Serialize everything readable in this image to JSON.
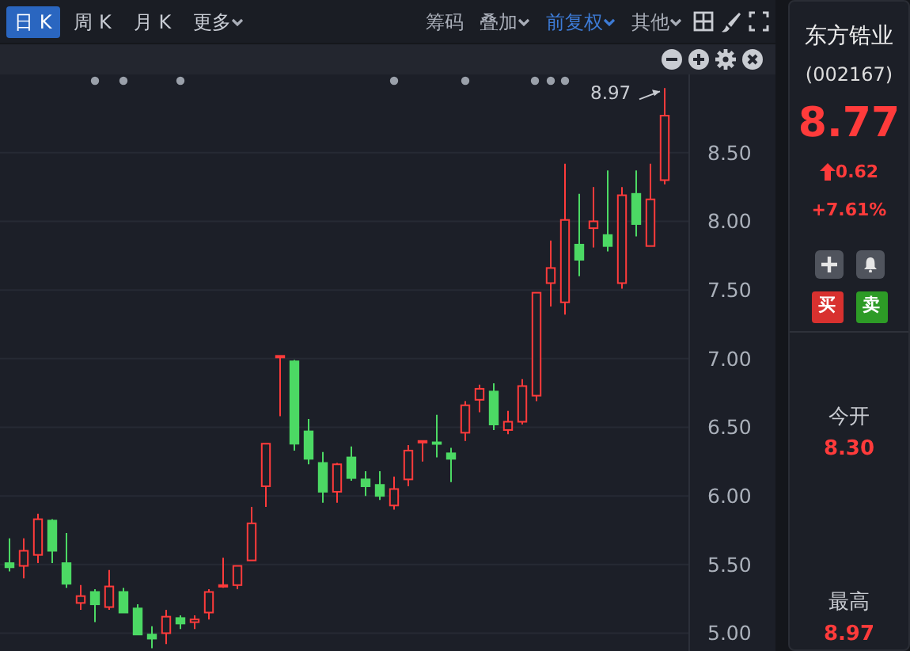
{
  "toolbar": {
    "periods": [
      {
        "label": "日 K",
        "selected": true,
        "dropdown": false
      },
      {
        "label": "周 K",
        "selected": false,
        "dropdown": false
      },
      {
        "label": "月 K",
        "selected": false,
        "dropdown": false
      },
      {
        "label": "更多",
        "selected": false,
        "dropdown": true
      }
    ],
    "options": [
      {
        "label": "筹码",
        "dropdown": false,
        "active": false
      },
      {
        "label": "叠加",
        "dropdown": true,
        "active": false
      },
      {
        "label": "前复权",
        "dropdown": true,
        "active": true
      },
      {
        "label": "其他",
        "dropdown": true,
        "active": false
      }
    ]
  },
  "chart": {
    "high_marker": "8.97",
    "chart_data": {
      "type": "candlestick",
      "grid": true,
      "ylim": [
        4.87,
        9.07
      ],
      "yticks": [
        {
          "value": 5,
          "label": "5.00"
        },
        {
          "value": 5.5,
          "label": "5.50"
        },
        {
          "value": 6,
          "label": "6.00"
        },
        {
          "value": 6.5,
          "label": "6.50"
        },
        {
          "value": 7,
          "label": "7.00"
        },
        {
          "value": 7.5,
          "label": "7.50"
        },
        {
          "value": 8,
          "label": "8.00"
        },
        {
          "value": 8.5,
          "label": "8.50"
        }
      ],
      "ohlc": [
        [
          5.51,
          5.69,
          5.45,
          5.48
        ],
        [
          5.49,
          5.69,
          5.4,
          5.6
        ],
        [
          5.57,
          5.87,
          5.51,
          5.83
        ],
        [
          5.82,
          5.83,
          5.51,
          5.6
        ],
        [
          5.51,
          5.73,
          5.33,
          5.36
        ],
        [
          5.22,
          5.35,
          5.17,
          5.27
        ],
        [
          5.3,
          5.32,
          5.08,
          5.21
        ],
        [
          5.19,
          5.46,
          5.17,
          5.34
        ],
        [
          5.3,
          5.33,
          5.15,
          5.15
        ],
        [
          5.18,
          5.21,
          4.99,
          4.99
        ],
        [
          4.99,
          5.05,
          4.89,
          4.96
        ],
        [
          5.0,
          5.17,
          4.92,
          5.12
        ],
        [
          5.11,
          5.13,
          5.03,
          5.07
        ],
        [
          5.08,
          5.13,
          5.03,
          5.1
        ],
        [
          5.15,
          5.32,
          5.1,
          5.3
        ],
        [
          5.34,
          5.55,
          5.33,
          5.35
        ],
        [
          5.35,
          5.49,
          5.32,
          5.49
        ],
        [
          5.53,
          5.92,
          5.53,
          5.8
        ],
        [
          6.07,
          6.38,
          5.92,
          6.38
        ],
        [
          7.01,
          7.02,
          6.58,
          7.02
        ],
        [
          6.98,
          6.99,
          6.33,
          6.38
        ],
        [
          6.47,
          6.56,
          6.23,
          6.27
        ],
        [
          6.24,
          6.32,
          5.95,
          6.03
        ],
        [
          6.03,
          6.24,
          5.95,
          6.23
        ],
        [
          6.28,
          6.36,
          6.11,
          6.13
        ],
        [
          6.12,
          6.18,
          6.0,
          6.07
        ],
        [
          6.08,
          6.18,
          5.97,
          6.0
        ],
        [
          5.93,
          6.14,
          5.9,
          6.05
        ],
        [
          6.12,
          6.37,
          6.07,
          6.33
        ],
        [
          6.39,
          6.4,
          6.25,
          6.4
        ],
        [
          6.39,
          6.59,
          6.28,
          6.38
        ],
        [
          6.31,
          6.35,
          6.1,
          6.27
        ],
        [
          6.46,
          6.69,
          6.4,
          6.66
        ],
        [
          6.7,
          6.81,
          6.61,
          6.78
        ],
        [
          6.76,
          6.82,
          6.48,
          6.52
        ],
        [
          6.48,
          6.62,
          6.45,
          6.54
        ],
        [
          6.54,
          6.85,
          6.52,
          6.8
        ],
        [
          6.73,
          7.48,
          6.69,
          7.48
        ],
        [
          7.55,
          7.86,
          7.38,
          7.66
        ],
        [
          7.41,
          8.42,
          7.32,
          8.01
        ],
        [
          7.83,
          8.2,
          7.6,
          7.72
        ],
        [
          7.95,
          8.25,
          7.81,
          8.0
        ],
        [
          7.9,
          8.37,
          7.78,
          7.82
        ],
        [
          7.55,
          8.25,
          7.51,
          8.19
        ],
        [
          8.2,
          8.37,
          7.89,
          7.98
        ],
        [
          7.82,
          8.42,
          7.82,
          8.16
        ],
        [
          8.3,
          8.97,
          8.27,
          8.77
        ]
      ]
    }
  },
  "quote": {
    "name": "东方锆业",
    "code": "(002167)",
    "price": "8.77",
    "change": "0.62",
    "change_percent": "+7.61%",
    "trade_buttons": [
      {
        "label": "买",
        "kind": "buy"
      },
      {
        "label": "卖",
        "kind": "sell"
      }
    ],
    "stats": [
      {
        "label": "今开",
        "value": "8.30"
      },
      {
        "label": "最高",
        "value": "8.97"
      }
    ]
  }
}
